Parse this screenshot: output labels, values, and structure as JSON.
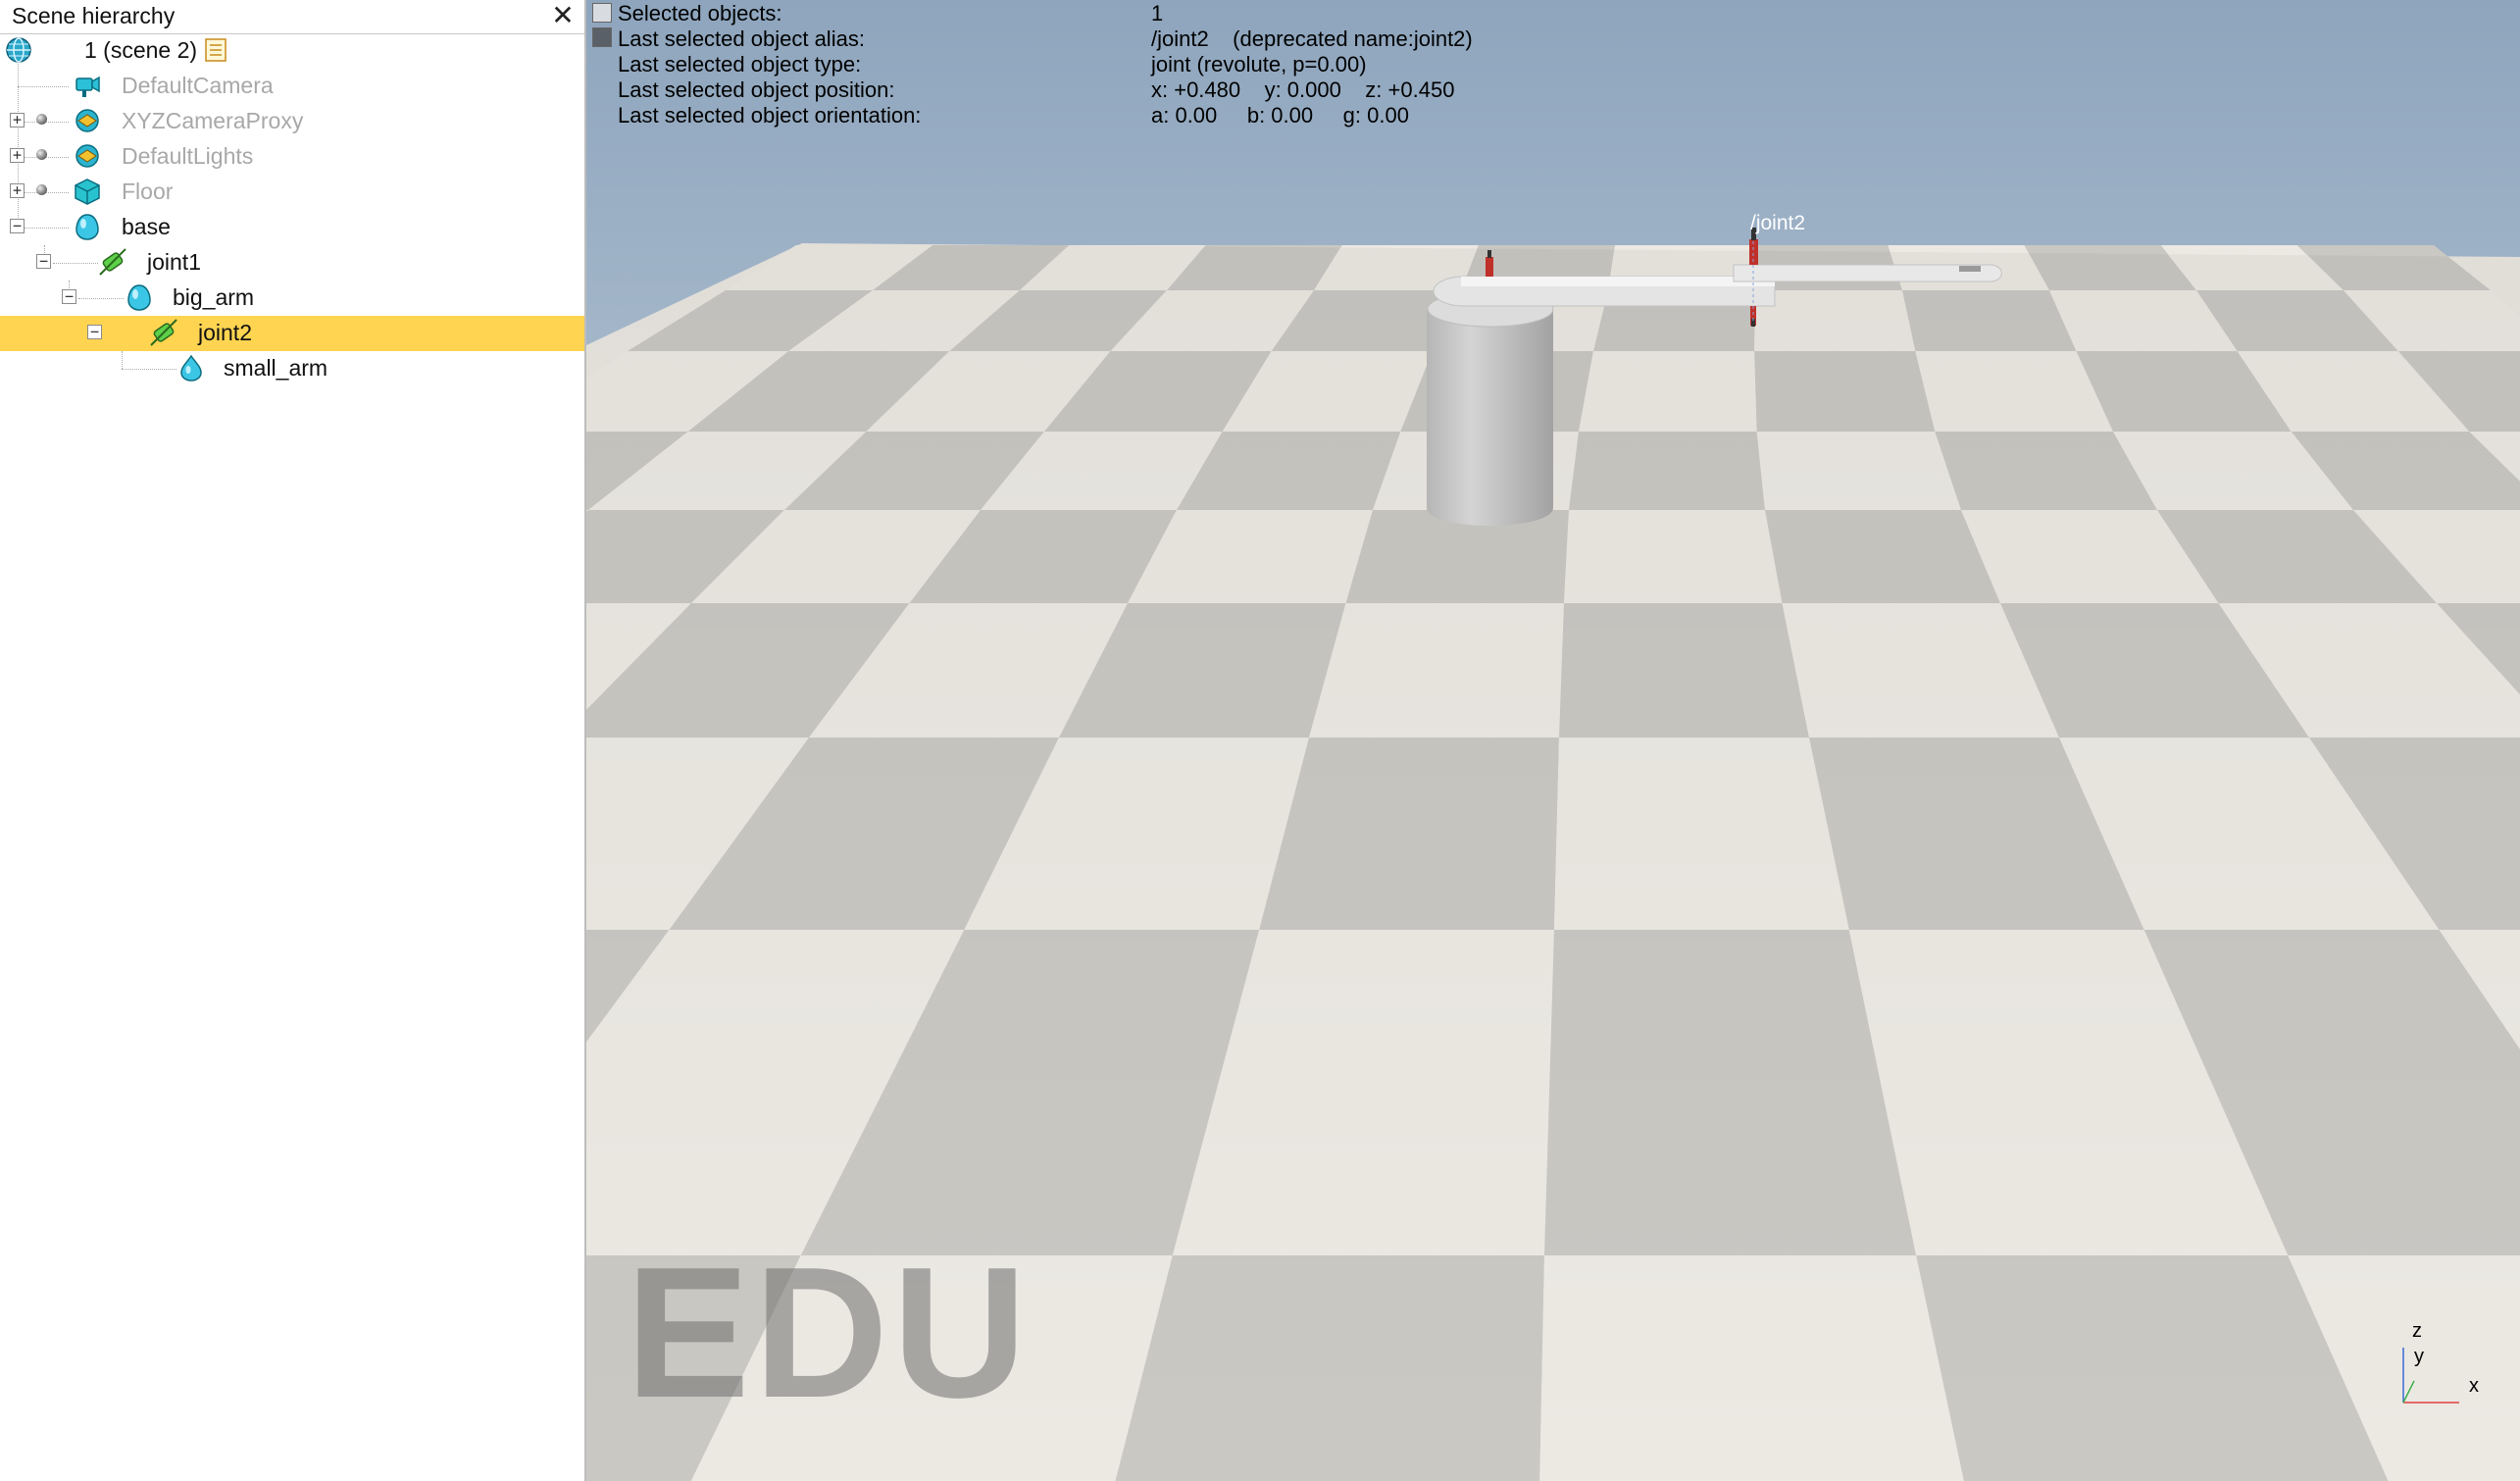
{
  "panel": {
    "title": "Scene hierarchy",
    "close_icon": "close-icon",
    "items": [
      {
        "label": "1 (scene 2)",
        "icon": "scene-globe-icon",
        "dim": false
      },
      {
        "label": "DefaultCamera",
        "icon": "camera-icon",
        "dim": true
      },
      {
        "label": "XYZCameraProxy",
        "icon": "dummy-icon",
        "dim": true
      },
      {
        "label": "DefaultLights",
        "icon": "dummy-icon",
        "dim": true
      },
      {
        "label": "Floor",
        "icon": "cube-icon",
        "dim": true
      },
      {
        "label": "base",
        "icon": "shape-icon",
        "dim": false
      },
      {
        "label": "joint1",
        "icon": "joint-icon",
        "dim": false
      },
      {
        "label": "big_arm",
        "icon": "shape-icon",
        "dim": false
      },
      {
        "label": "joint2",
        "icon": "joint-icon",
        "dim": false,
        "selected": true
      },
      {
        "label": "small_arm",
        "icon": "shape-icon",
        "dim": false
      }
    ]
  },
  "info": {
    "rows": [
      {
        "key": "Selected objects:",
        "value": "1"
      },
      {
        "key": "Last selected object alias:",
        "value": "/joint2    (deprecated name:joint2)"
      },
      {
        "key": "Last selected object type:",
        "value": "joint (revolute, p=0.00)"
      },
      {
        "key": "Last selected object position:",
        "value": "x: +0.480    y: 0.000    z: +0.450"
      },
      {
        "key": "Last selected object orientation:",
        "value": "a: 0.00     b: 0.00     g: 0.00"
      }
    ]
  },
  "viewport": {
    "joint_label": "/joint2",
    "watermark": "EDU",
    "axes": {
      "z": "z",
      "y": "y",
      "x": "x"
    }
  },
  "colors": {
    "selection": "#fed450",
    "sky_top": "#8fa6be",
    "sky_bottom": "#e6eaee",
    "tile_light": "#ece9e3",
    "tile_dark": "#cac8c3",
    "joint_red": "#c0302a"
  }
}
